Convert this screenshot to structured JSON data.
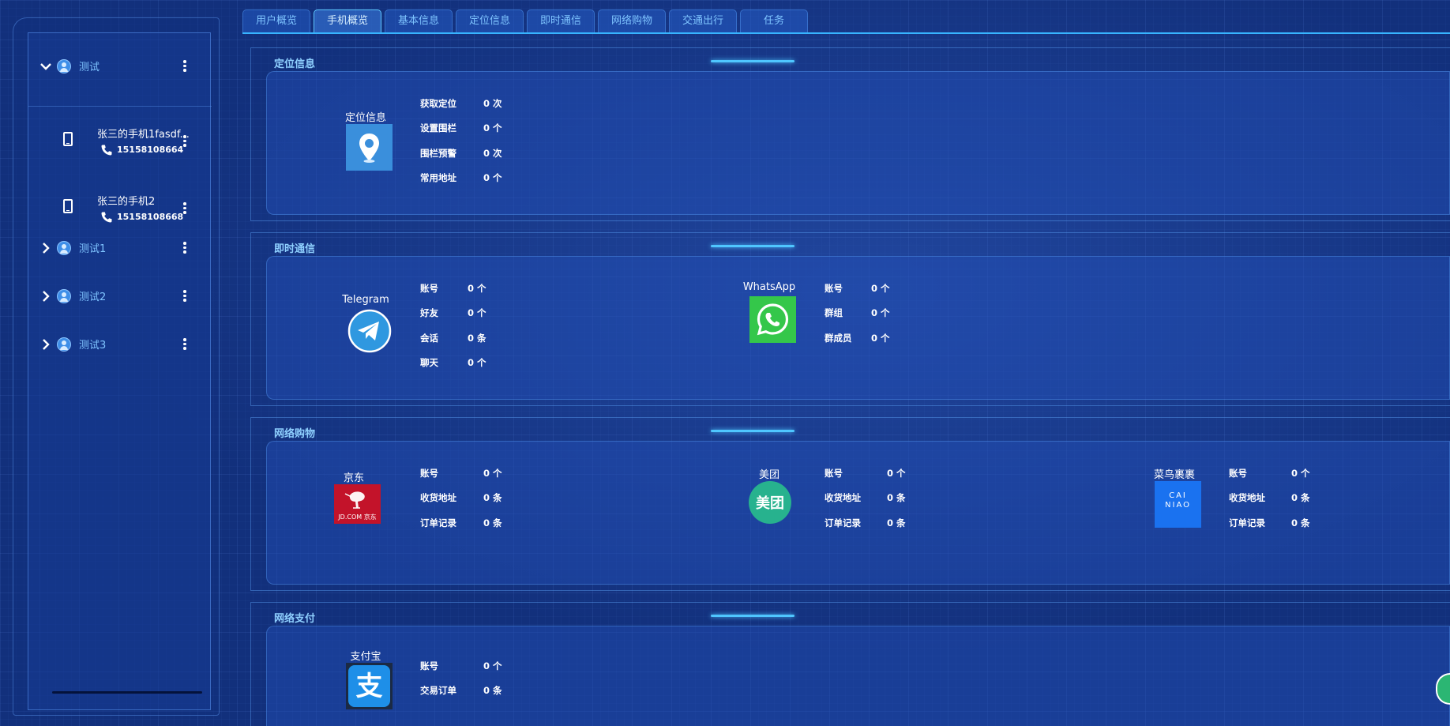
{
  "tabs": [
    {
      "label": "用户概览",
      "active": false
    },
    {
      "label": "手机概览",
      "active": true
    },
    {
      "label": "基本信息",
      "active": false
    },
    {
      "label": "定位信息",
      "active": false
    },
    {
      "label": "即时通信",
      "active": false
    },
    {
      "label": "网络购物",
      "active": false
    },
    {
      "label": "交通出行",
      "active": false
    },
    {
      "label": "任务",
      "active": false
    }
  ],
  "sidebar": {
    "groups": [
      {
        "label": "测试",
        "expanded": true
      },
      {
        "label": "测试1",
        "expanded": false
      },
      {
        "label": "测试2",
        "expanded": false
      },
      {
        "label": "测试3",
        "expanded": false
      }
    ],
    "devices": [
      {
        "name": "张三的手机1fasdf...",
        "phone": "15158108664"
      },
      {
        "name": "张三的手机2",
        "phone": "15158108668"
      }
    ]
  },
  "sections": {
    "location": {
      "title": "定位信息",
      "apps": [
        {
          "name": "定位信息",
          "icon": "location-pin-icon",
          "stats": [
            {
              "label": "获取定位",
              "value": "0 次"
            },
            {
              "label": "设置围栏",
              "value": "0 个"
            },
            {
              "label": "围栏预警",
              "value": "0 次"
            },
            {
              "label": "常用地址",
              "value": "0 个"
            }
          ]
        }
      ]
    },
    "im": {
      "title": "即时通信",
      "apps": [
        {
          "name": "Telegram",
          "icon": "telegram-icon",
          "stats": [
            {
              "label": "账号",
              "value": "0 个"
            },
            {
              "label": "好友",
              "value": "0 个"
            },
            {
              "label": "会话",
              "value": "0 条"
            },
            {
              "label": "聊天",
              "value": "0 个"
            }
          ]
        },
        {
          "name": "WhatsApp",
          "icon": "whatsapp-icon",
          "stats": [
            {
              "label": "账号",
              "value": "0 个"
            },
            {
              "label": "群组",
              "value": "0 个"
            },
            {
              "label": "群成员",
              "value": "0 个"
            }
          ]
        }
      ]
    },
    "shopping": {
      "title": "网络购物",
      "apps": [
        {
          "name": "京东",
          "icon": "jd-icon",
          "logo_text": "JD.COM 京东",
          "stats": [
            {
              "label": "账号",
              "value": "0 个"
            },
            {
              "label": "收货地址",
              "value": "0 条"
            },
            {
              "label": "订单记录",
              "value": "0 条"
            }
          ]
        },
        {
          "name": "美团",
          "icon": "meituan-icon",
          "logo_text": "美团",
          "stats": [
            {
              "label": "账号",
              "value": "0 个"
            },
            {
              "label": "收货地址",
              "value": "0 条"
            },
            {
              "label": "订单记录",
              "value": "0 条"
            }
          ]
        },
        {
          "name": "菜鸟裹裹",
          "icon": "cainiao-icon",
          "logo_text": "CAI NIAO",
          "stats": [
            {
              "label": "账号",
              "value": "0 个"
            },
            {
              "label": "收货地址",
              "value": "0 条"
            },
            {
              "label": "订单记录",
              "value": "0 条"
            }
          ]
        }
      ]
    },
    "payment": {
      "title": "网络支付",
      "apps": [
        {
          "name": "支付宝",
          "icon": "alipay-icon",
          "logo_text": "支",
          "stats": [
            {
              "label": "账号",
              "value": "0 个"
            },
            {
              "label": "交易订单",
              "value": "0 条"
            }
          ]
        }
      ]
    }
  },
  "colors": {
    "background": "#12307c",
    "accent": "#37b4ff",
    "tab_text": "#7ec4ff",
    "location_logo": "#3a8fdc",
    "whatsapp": "#34c74a",
    "jd": "#c3132a",
    "meituan": "#27b28e",
    "cainiao": "#1a72f0",
    "alipay": "#1e8fe8"
  }
}
